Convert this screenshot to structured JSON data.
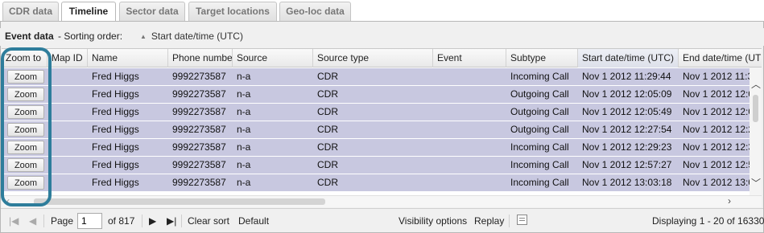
{
  "tabs": [
    {
      "label": "CDR data",
      "active": false
    },
    {
      "label": "Timeline",
      "active": true
    },
    {
      "label": "Sector data",
      "active": false
    },
    {
      "label": "Target locations",
      "active": false
    },
    {
      "label": "Geo-loc data",
      "active": false
    }
  ],
  "toolbar": {
    "title": "Event data",
    "sort_label": "- Sorting order:",
    "sort_value": "Start date/time (UTC)"
  },
  "columns": [
    "Zoom to",
    "Map ID",
    "Name",
    "Phone number",
    "Source",
    "Source type",
    "Event",
    "Subtype",
    "Start date/time (UTC)",
    "End date/time (UTC)"
  ],
  "rows": [
    {
      "zoom": "Zoom",
      "map_id": "",
      "name": "Fred Higgs",
      "phone": "9992273587",
      "source": "n-a",
      "source_type": "CDR",
      "event": "",
      "subtype": "Incoming Call",
      "start": "Nov 1 2012 11:29:44",
      "end": "Nov 1 2012 11:3"
    },
    {
      "zoom": "Zoom",
      "map_id": "",
      "name": "Fred Higgs",
      "phone": "9992273587",
      "source": "n-a",
      "source_type": "CDR",
      "event": "",
      "subtype": "Outgoing Call",
      "start": "Nov 1 2012 12:05:09",
      "end": "Nov 1 2012 12:0"
    },
    {
      "zoom": "Zoom",
      "map_id": "",
      "name": "Fred Higgs",
      "phone": "9992273587",
      "source": "n-a",
      "source_type": "CDR",
      "event": "",
      "subtype": "Outgoing Call",
      "start": "Nov 1 2012 12:05:49",
      "end": "Nov 1 2012 12:0"
    },
    {
      "zoom": "Zoom",
      "map_id": "",
      "name": "Fred Higgs",
      "phone": "9992273587",
      "source": "n-a",
      "source_type": "CDR",
      "event": "",
      "subtype": "Outgoing Call",
      "start": "Nov 1 2012 12:27:54",
      "end": "Nov 1 2012 12:2"
    },
    {
      "zoom": "Zoom",
      "map_id": "",
      "name": "Fred Higgs",
      "phone": "9992273587",
      "source": "n-a",
      "source_type": "CDR",
      "event": "",
      "subtype": "Incoming Call",
      "start": "Nov 1 2012 12:29:23",
      "end": "Nov 1 2012 12:3"
    },
    {
      "zoom": "Zoom",
      "map_id": "",
      "name": "Fred Higgs",
      "phone": "9992273587",
      "source": "n-a",
      "source_type": "CDR",
      "event": "",
      "subtype": "Incoming Call",
      "start": "Nov 1 2012 12:57:27",
      "end": "Nov 1 2012 12:5"
    },
    {
      "zoom": "Zoom",
      "map_id": "",
      "name": "Fred Higgs",
      "phone": "9992273587",
      "source": "n-a",
      "source_type": "CDR",
      "event": "",
      "subtype": "Incoming Call",
      "start": "Nov 1 2012 13:03:18",
      "end": "Nov 1 2012 13:0"
    }
  ],
  "pager": {
    "page_label": "Page",
    "page_value": "1",
    "of_label": "of 817",
    "clear_sort": "Clear sort",
    "default": "Default",
    "visibility": "Visibility options",
    "replay": "Replay",
    "displaying": "Displaying 1 - 20 of 16330"
  },
  "colors": {
    "row_background": "#c8c8e0",
    "highlight_ring": "#2e7d9b"
  }
}
